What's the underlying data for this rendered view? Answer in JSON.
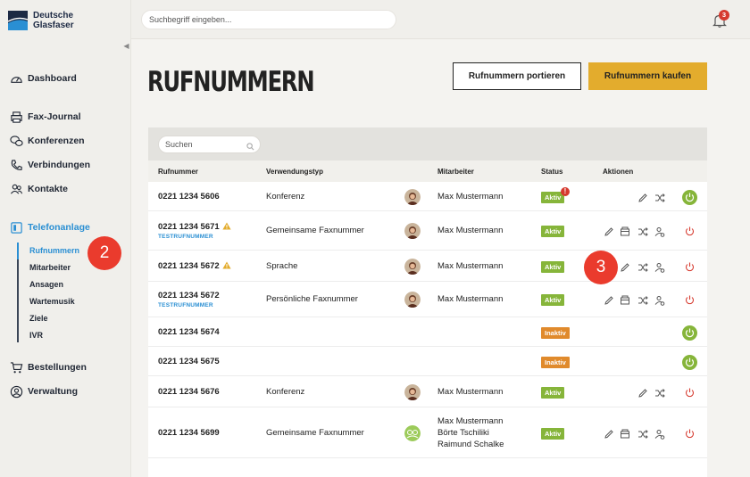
{
  "brand": {
    "line1": "Deutsche",
    "line2": "Glasfaser"
  },
  "topbar": {
    "search_placeholder": "Suchbegriff eingeben...",
    "notification_count": "3"
  },
  "sidebar": {
    "items": [
      {
        "label": "Dashboard",
        "icon": "gauge-icon"
      },
      {
        "label": "Fax-Journal",
        "icon": "printer-icon"
      },
      {
        "label": "Konferenzen",
        "icon": "chat-icon"
      },
      {
        "label": "Verbindungen",
        "icon": "phone-icon"
      },
      {
        "label": "Kontakte",
        "icon": "contacts-icon"
      },
      {
        "label": "Telefonanlage",
        "icon": "phone-system-icon"
      },
      {
        "label": "Bestellungen",
        "icon": "cart-icon"
      },
      {
        "label": "Verwaltung",
        "icon": "user-circle-icon"
      }
    ],
    "sub_items": [
      "Rufnummern",
      "Mitarbeiter",
      "Ansagen",
      "Wartemusik",
      "Ziele",
      "IVR"
    ]
  },
  "page": {
    "title": "RUFNUMMERN",
    "port_button": "Rufnummern portieren",
    "buy_button": "Rufnummern kaufen"
  },
  "table": {
    "search_placeholder": "Suchen",
    "headers": {
      "number": "Rufnummer",
      "usage": "Verwendungstyp",
      "employee": "Mitarbeiter",
      "status": "Status",
      "actions": "Aktionen"
    },
    "rows": [
      {
        "number": "0221 1234 5606",
        "usage": "Konferenz",
        "employee": "Max Mustermann",
        "status": "Aktiv"
      },
      {
        "number": "0221 1234 5671",
        "test": "TESTRUFNUMMER",
        "usage": "Gemeinsame Faxnummer",
        "employee": "Max Mustermann",
        "status": "Aktiv"
      },
      {
        "number": "0221 1234 5672",
        "usage": "Sprache",
        "employee": "Max Mustermann",
        "status": "Aktiv"
      },
      {
        "number": "0221 1234 5672",
        "test": "TESTRUFNUMMER",
        "usage": "Persönliche Faxnummer",
        "employee": "Max Mustermann",
        "status": "Aktiv"
      },
      {
        "number": "0221 1234 5674",
        "status": "Inaktiv"
      },
      {
        "number": "0221 1234 5675",
        "status": "Inaktiv"
      },
      {
        "number": "0221 1234 5676",
        "usage": "Konferenz",
        "employee": "Max Mustermann",
        "status": "Aktiv"
      },
      {
        "number": "0221 1234 5699",
        "usage": "Gemeinsame Faxnummer",
        "employees": [
          "Max Mustermann",
          "Börte Tschiliki",
          "Raimund Schalke"
        ],
        "status": "Aktiv"
      }
    ]
  },
  "callouts": [
    "2",
    "3"
  ],
  "colors": {
    "accent": "#2a8fd3",
    "buy": "#e3ac2d",
    "active": "#86b53a",
    "inactive": "#e08a2c",
    "alert": "#d63a2f"
  }
}
